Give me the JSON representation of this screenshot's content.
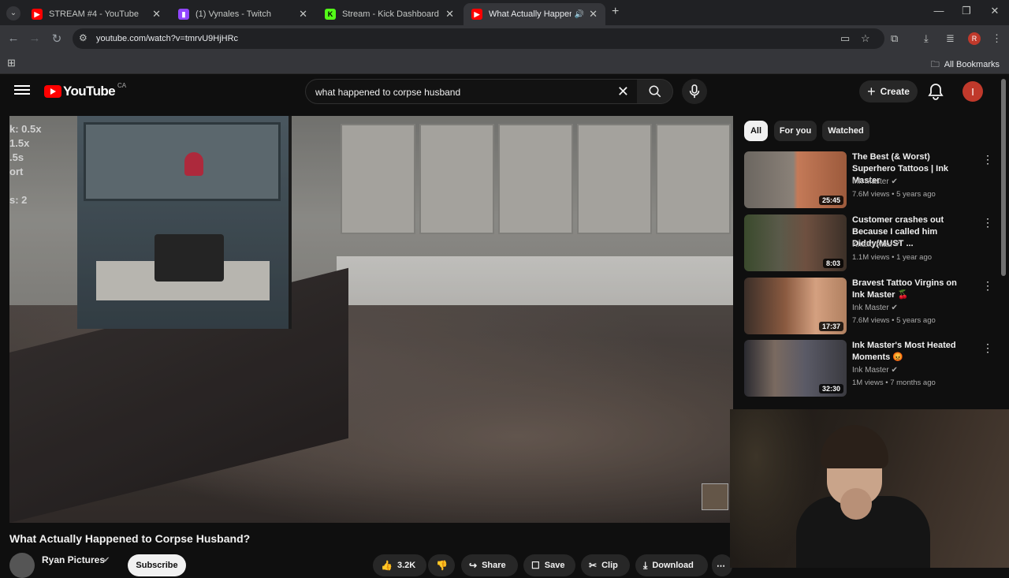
{
  "browser": {
    "tabs": [
      {
        "title": "STREAM #4 - YouTube",
        "favicon_color": "#ff0000"
      },
      {
        "title": "(1) Vynales - Twitch",
        "favicon_color": "#9146ff"
      },
      {
        "title": "Stream - Kick Dashboard",
        "favicon_color": "#53fc18",
        "favicon_letter": "K"
      },
      {
        "title": "What Actually Happened to",
        "favicon_color": "#ff0000"
      }
    ],
    "url": "youtube.com/watch?v=tmrvU9HjHRc",
    "profile_letter": "R",
    "all_bookmarks": "All Bookmarks"
  },
  "youtube": {
    "logo_text": "YouTube",
    "country_code": "CA",
    "search_query": "what happened to corpse husband",
    "create_label": "Create",
    "user_initial": "I"
  },
  "player": {
    "speed_overlay": [
      "k: 0.5x",
      "1.5x",
      ".5s",
      "ort",
      "",
      "s: 2"
    ]
  },
  "video": {
    "title": "What Actually Happened to Corpse Husband?",
    "channel": "Ryan Pictures",
    "subscribe_label": "Subscribe",
    "likes": "3.2K",
    "share_label": "Share",
    "save_label": "Save",
    "clip_label": "Clip",
    "download_label": "Download"
  },
  "sidebar": {
    "chips": [
      "All",
      "For you",
      "Watched"
    ],
    "recommendations": [
      {
        "title": "The Best (& Worst) Superhero Tattoos | Ink Master",
        "channel": "Ink Master",
        "meta": "7.6M views • 5 years ago",
        "duration": "25:45"
      },
      {
        "title": "Customer crashes out Because I called him Diddy(MUST ...",
        "channel": "Khalid Attaf",
        "meta": "1.1M views • 1 year ago",
        "duration": "8:03"
      },
      {
        "title": "Bravest Tattoo Virgins on Ink Master 🍒",
        "channel": "Ink Master",
        "meta": "7.6M views • 5 years ago",
        "duration": "17:37"
      },
      {
        "title": "Ink Master's Most Heated Moments 😡",
        "channel": "Ink Master",
        "meta": "1M views • 7 months ago",
        "duration": "32:30"
      }
    ]
  }
}
